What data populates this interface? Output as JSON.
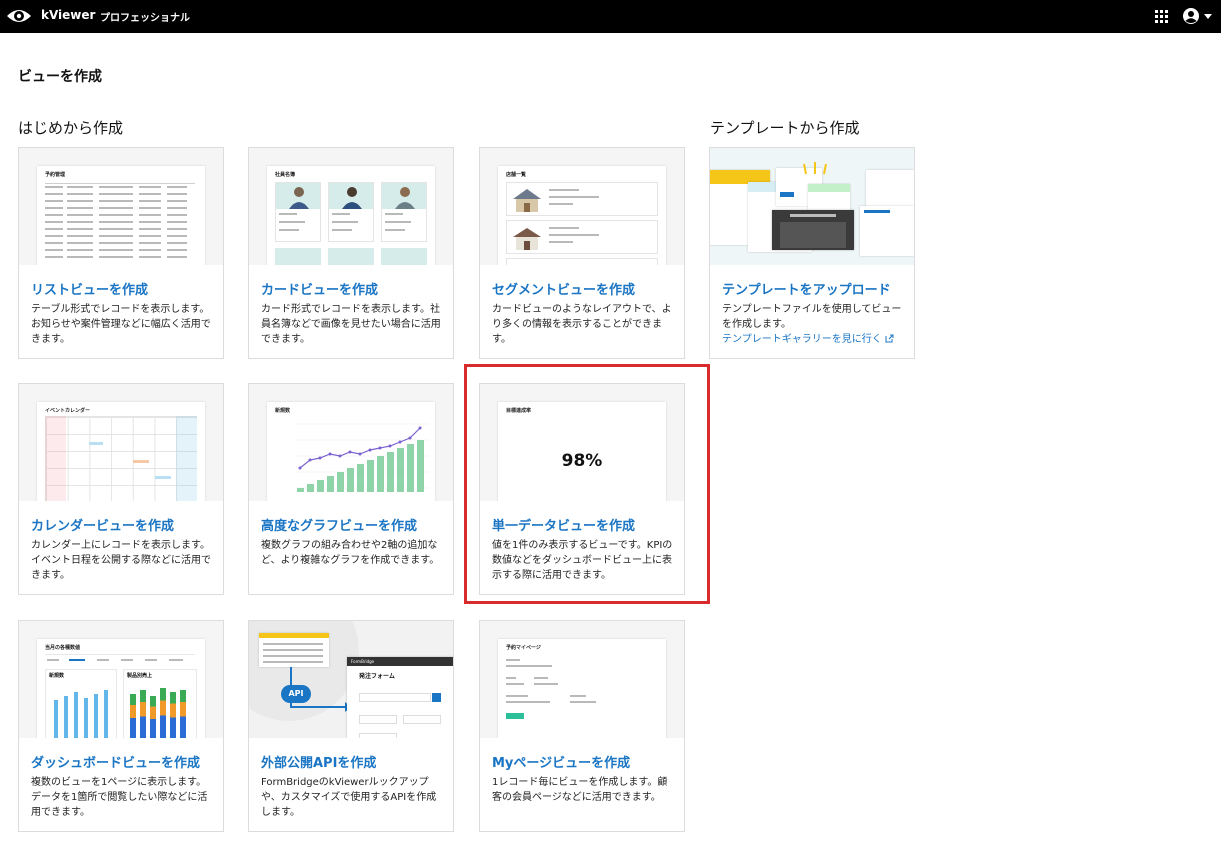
{
  "header": {
    "app_name": "kViewer",
    "edition": "プロフェッショナル",
    "icons": [
      "kviewer-eye-logo",
      "apps-grid-icon",
      "account-icon",
      "caret-down-icon"
    ]
  },
  "page": {
    "title": "ビューを作成",
    "section_scratch": "はじめから作成",
    "section_template": "テンプレートから作成"
  },
  "cards": {
    "list": {
      "title": "リストビューを作成",
      "desc": "テーブル形式でレコードを表示します。お知らせや案件管理などに幅広く活用できます。",
      "preview_title": "予約管理"
    },
    "card": {
      "title": "カードビューを作成",
      "desc": "カード形式でレコードを表示します。社員名簿などで画像を見せたい場合に活用できます。",
      "preview_title": "社員名簿"
    },
    "segment": {
      "title": "セグメントビューを作成",
      "desc": "カードビューのようなレイアウトで、より多くの情報を表示することができます。",
      "preview_title": "店舗一覧"
    },
    "template": {
      "title": "テンプレートをアップロード",
      "desc": "テンプレートファイルを使用してビューを作成します。",
      "link": "テンプレートギャラリーを見に行く"
    },
    "calendar": {
      "title": "カレンダービューを作成",
      "desc": "カレンダー上にレコードを表示します。イベント日程を公開する際などに活用できます。",
      "preview_title": "イベントカレンダー"
    },
    "graph": {
      "title": "高度なグラフビューを作成",
      "desc": "複数グラフの組み合わせや2軸の追加など、より複雑なグラフを作成できます。",
      "preview_title": "新規数"
    },
    "single": {
      "title": "単一データビューを作成",
      "desc": "値を1件のみ表示するビューです。KPIの数値などをダッシュボードビュー上に表示する際に活用できます。",
      "preview_title": "目標達成率",
      "preview_value": "98%"
    },
    "dashboard": {
      "title": "ダッシュボードビューを作成",
      "desc": "複数のビューを1ページに表示します。データを1箇所で閲覧したい際などに活用できます。",
      "preview_title": "当月の各種数値",
      "preview_sub1": "新規数",
      "preview_sub2": "製品別売上"
    },
    "api": {
      "title": "外部公開APIを作成",
      "desc": "FormBridgeのkViewerルックアップや、カスタマイズで使用するAPIを作成します。",
      "preview_badge": "API",
      "preview_form": "FormBridge",
      "preview_form_title": "発注フォーム"
    },
    "mypage": {
      "title": "Myページビューを作成",
      "desc": "1レコード毎にビューを作成します。顧客の会員ページなどに活用できます。",
      "preview_title": "予約マイページ"
    }
  },
  "colors": {
    "accent": "#1a75c4",
    "highlight": "#d92b2b",
    "topbar": "#000000",
    "graph_bars": "#8fd3a8",
    "graph_line": "#7b61d1"
  }
}
